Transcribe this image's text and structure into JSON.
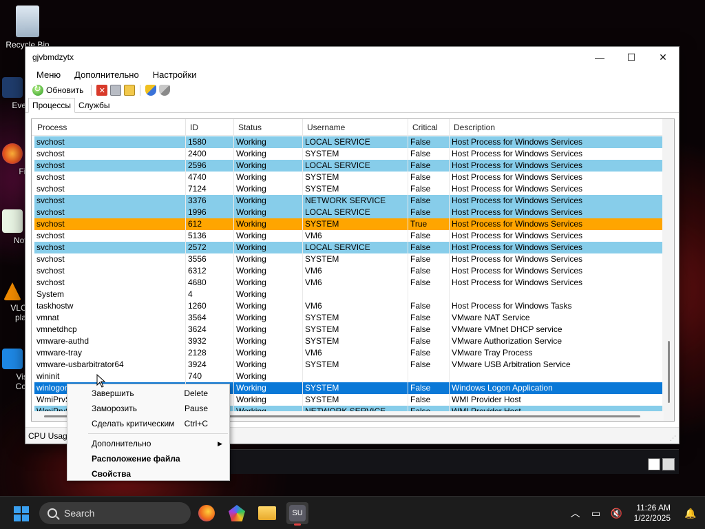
{
  "desktop": {
    "icons": [
      {
        "label": "Recycle Bin"
      },
      {
        "label": "Every"
      },
      {
        "label": "Fire"
      },
      {
        "label": "Notep"
      },
      {
        "label": "VLC m"
      },
      {
        "label": "pla"
      },
      {
        "label": "Visual"
      },
      {
        "label": "Co"
      }
    ]
  },
  "window": {
    "title": "gjvbmdzytx",
    "controls": {
      "minimize": "—",
      "maximize": "☐",
      "close": "✕"
    }
  },
  "menubar": [
    "Меню",
    "Дополнительно",
    "Настройки"
  ],
  "toolbar": {
    "refresh_label": "Обновить"
  },
  "tabs": [
    "Процессы",
    "Службы"
  ],
  "columns": [
    "Process",
    "ID",
    "Status",
    "Username",
    "Critical",
    "Description"
  ],
  "rows": [
    {
      "process": "svchost",
      "id": "1580",
      "status": "Working",
      "user": "LOCAL SERVICE",
      "critical": "False",
      "desc": "Host Process for Windows Services",
      "style": "blue"
    },
    {
      "process": "svchost",
      "id": "2400",
      "status": "Working",
      "user": "SYSTEM",
      "critical": "False",
      "desc": "Host Process for Windows Services",
      "style": "white"
    },
    {
      "process": "svchost",
      "id": "2596",
      "status": "Working",
      "user": "LOCAL SERVICE",
      "critical": "False",
      "desc": "Host Process for Windows Services",
      "style": "blue"
    },
    {
      "process": "svchost",
      "id": "4740",
      "status": "Working",
      "user": "SYSTEM",
      "critical": "False",
      "desc": "Host Process for Windows Services",
      "style": "white"
    },
    {
      "process": "svchost",
      "id": "7124",
      "status": "Working",
      "user": "SYSTEM",
      "critical": "False",
      "desc": "Host Process for Windows Services",
      "style": "white"
    },
    {
      "process": "svchost",
      "id": "3376",
      "status": "Working",
      "user": "NETWORK SERVICE",
      "critical": "False",
      "desc": "Host Process for Windows Services",
      "style": "blue"
    },
    {
      "process": "svchost",
      "id": "1996",
      "status": "Working",
      "user": "LOCAL SERVICE",
      "critical": "False",
      "desc": "Host Process for Windows Services",
      "style": "blue"
    },
    {
      "process": "svchost",
      "id": "612",
      "status": "Working",
      "user": "SYSTEM",
      "critical": "True",
      "desc": "Host Process for Windows Services",
      "style": "orange"
    },
    {
      "process": "svchost",
      "id": "5136",
      "status": "Working",
      "user": "VM6",
      "critical": "False",
      "desc": "Host Process for Windows Services",
      "style": "white"
    },
    {
      "process": "svchost",
      "id": "2572",
      "status": "Working",
      "user": "LOCAL SERVICE",
      "critical": "False",
      "desc": "Host Process for Windows Services",
      "style": "blue"
    },
    {
      "process": "svchost",
      "id": "3556",
      "status": "Working",
      "user": "SYSTEM",
      "critical": "False",
      "desc": "Host Process for Windows Services",
      "style": "white"
    },
    {
      "process": "svchost",
      "id": "6312",
      "status": "Working",
      "user": "VM6",
      "critical": "False",
      "desc": "Host Process for Windows Services",
      "style": "white"
    },
    {
      "process": "svchost",
      "id": "4680",
      "status": "Working",
      "user": "VM6",
      "critical": "False",
      "desc": "Host Process for Windows Services",
      "style": "white"
    },
    {
      "process": "System",
      "id": "4",
      "status": "Working",
      "user": "",
      "critical": "",
      "desc": "",
      "style": "white"
    },
    {
      "process": "taskhostw",
      "id": "1260",
      "status": "Working",
      "user": "VM6",
      "critical": "False",
      "desc": "Host Process for Windows Tasks",
      "style": "white"
    },
    {
      "process": "vmnat",
      "id": "3564",
      "status": "Working",
      "user": "SYSTEM",
      "critical": "False",
      "desc": "VMware NAT Service",
      "style": "white"
    },
    {
      "process": "vmnetdhcp",
      "id": "3624",
      "status": "Working",
      "user": "SYSTEM",
      "critical": "False",
      "desc": "VMware VMnet DHCP service",
      "style": "white"
    },
    {
      "process": "vmware-authd",
      "id": "3932",
      "status": "Working",
      "user": "SYSTEM",
      "critical": "False",
      "desc": "VMware Authorization Service",
      "style": "white"
    },
    {
      "process": "vmware-tray",
      "id": "2128",
      "status": "Working",
      "user": "VM6",
      "critical": "False",
      "desc": "VMware Tray Process",
      "style": "white"
    },
    {
      "process": "vmware-usbarbitrator64",
      "id": "3924",
      "status": "Working",
      "user": "SYSTEM",
      "critical": "False",
      "desc": "VMware USB Arbitration Service",
      "style": "white"
    },
    {
      "process": "wininit",
      "id": "740",
      "status": "Working",
      "user": "",
      "critical": "",
      "desc": "",
      "style": "white"
    },
    {
      "process": "winlogon",
      "id": "",
      "status": "Working",
      "user": "SYSTEM",
      "critical": "False",
      "desc": "Windows Logon Application",
      "style": "sel"
    },
    {
      "process": "WmiPrvS",
      "id": "",
      "status": "Working",
      "user": "SYSTEM",
      "critical": "False",
      "desc": "WMI Provider Host",
      "style": "white"
    },
    {
      "process": "WmiPrvS",
      "id": "",
      "status": "Working",
      "user": "NETWORK SERVICE",
      "critical": "False",
      "desc": "WMI Provider Host",
      "style": "blue"
    }
  ],
  "statusbar": {
    "text": "CPU Usage"
  },
  "context_menu": {
    "items": [
      {
        "label": "Завершить",
        "shortcut": "Delete"
      },
      {
        "label": "Заморозить",
        "shortcut": "Pause"
      },
      {
        "label": "Сделать критическим",
        "shortcut": "Ctrl+C"
      },
      {
        "label": "Дополнительно",
        "shortcut": ""
      },
      {
        "label": "Расположение файла",
        "shortcut": ""
      },
      {
        "label": "Свойства",
        "shortcut": ""
      }
    ]
  },
  "taskbar": {
    "search_placeholder": "Search",
    "time": "11:26 AM",
    "date": "1/22/2025",
    "active_app_label": "SU"
  },
  "colors": {
    "row_blue": "#87cdea",
    "row_critical": "#ffa500",
    "row_selected": "#0a78d7"
  }
}
